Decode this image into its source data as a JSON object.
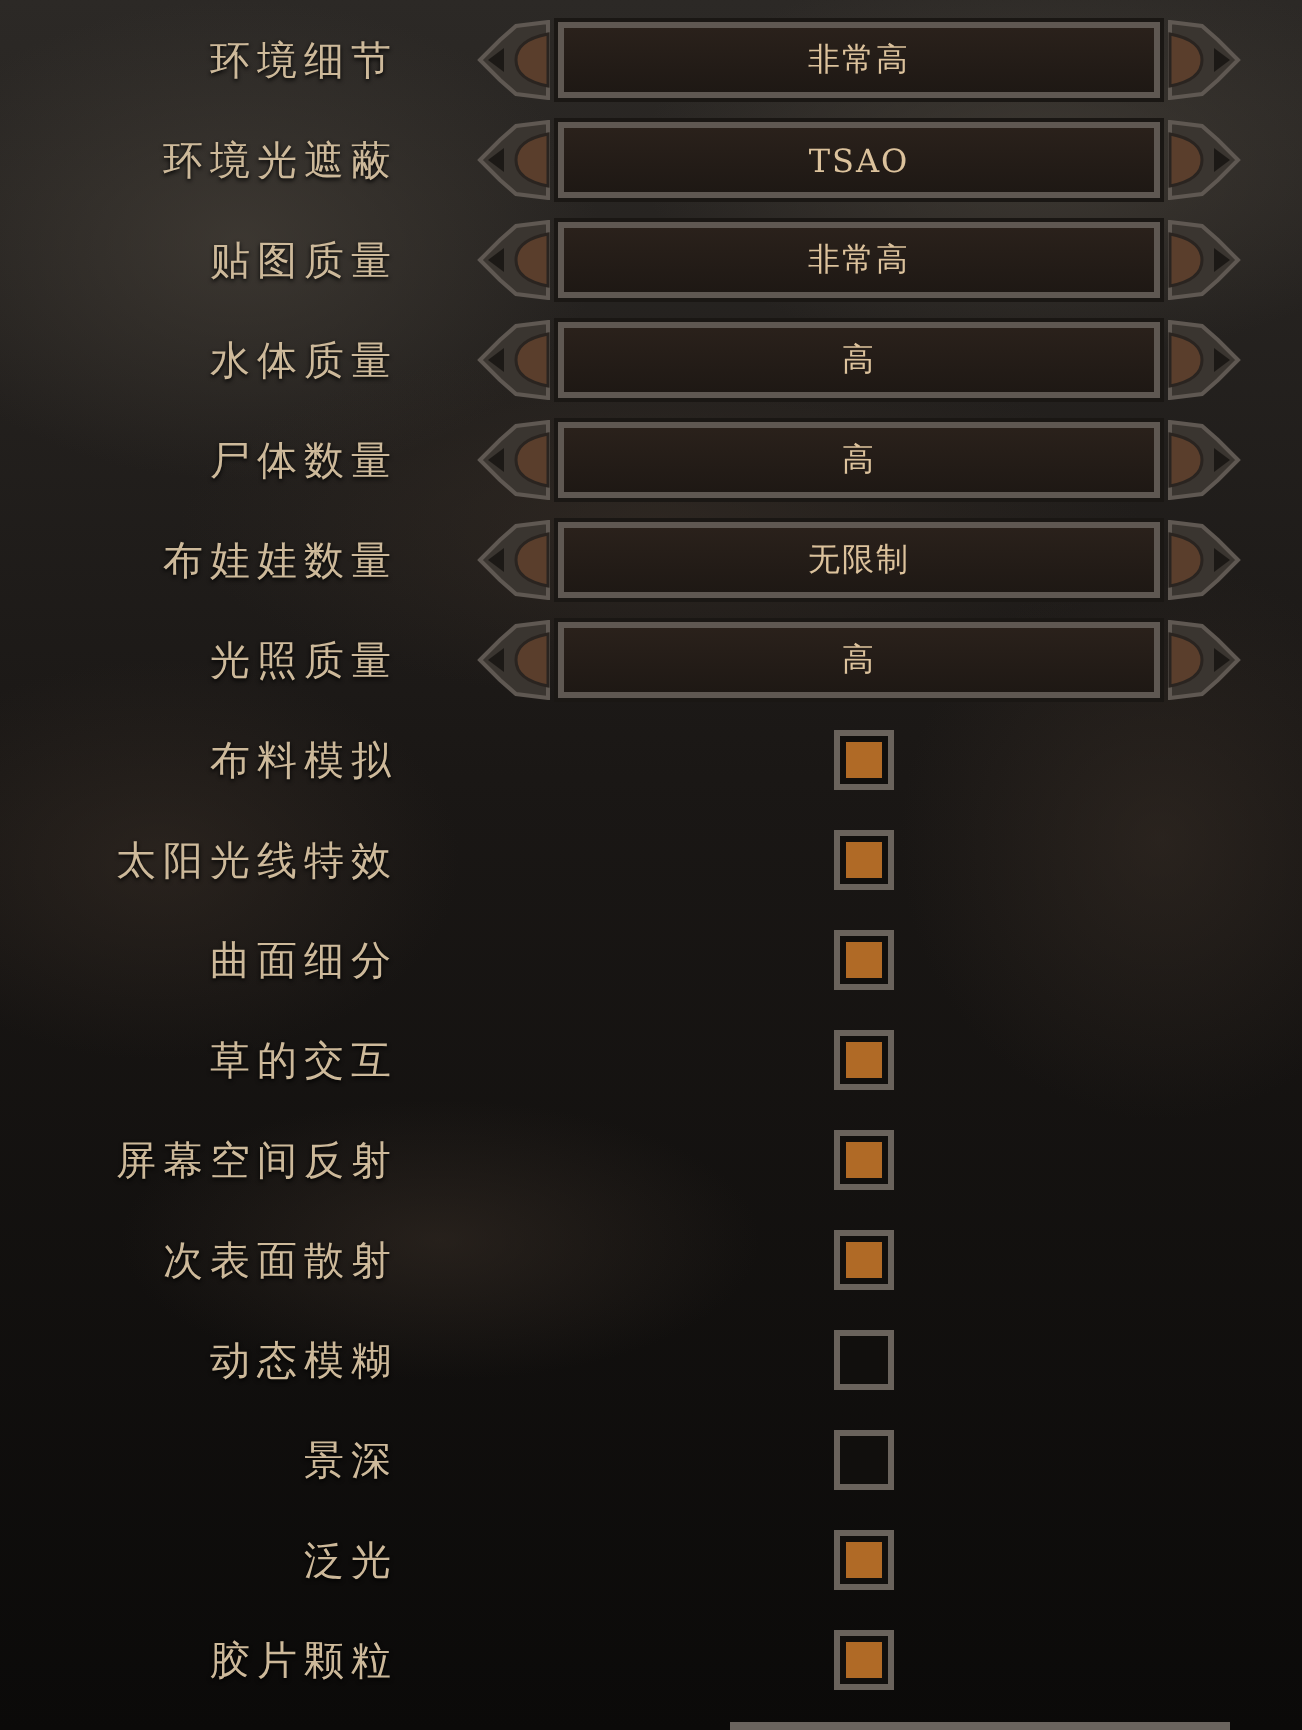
{
  "settings": [
    {
      "kind": "selector",
      "label": "环境细节",
      "value": "非常高"
    },
    {
      "kind": "selector",
      "label": "环境光遮蔽",
      "value": "TSAO"
    },
    {
      "kind": "selector",
      "label": "贴图质量",
      "value": "非常高"
    },
    {
      "kind": "selector",
      "label": "水体质量",
      "value": "高"
    },
    {
      "kind": "selector",
      "label": "尸体数量",
      "value": "高"
    },
    {
      "kind": "selector",
      "label": "布娃娃数量",
      "value": "无限制"
    },
    {
      "kind": "selector",
      "label": "光照质量",
      "value": "高"
    },
    {
      "kind": "checkbox",
      "label": "布料模拟",
      "checked": true
    },
    {
      "kind": "checkbox",
      "label": "太阳光线特效",
      "checked": true
    },
    {
      "kind": "checkbox",
      "label": "曲面细分",
      "checked": true
    },
    {
      "kind": "checkbox",
      "label": "草的交互",
      "checked": true
    },
    {
      "kind": "checkbox",
      "label": "屏幕空间反射",
      "checked": true
    },
    {
      "kind": "checkbox",
      "label": "次表面散射",
      "checked": true
    },
    {
      "kind": "checkbox",
      "label": "动态模糊",
      "checked": false
    },
    {
      "kind": "checkbox",
      "label": "景深",
      "checked": false
    },
    {
      "kind": "checkbox",
      "label": "泛光",
      "checked": true
    },
    {
      "kind": "checkbox",
      "label": "胶片颗粒",
      "checked": true
    }
  ]
}
